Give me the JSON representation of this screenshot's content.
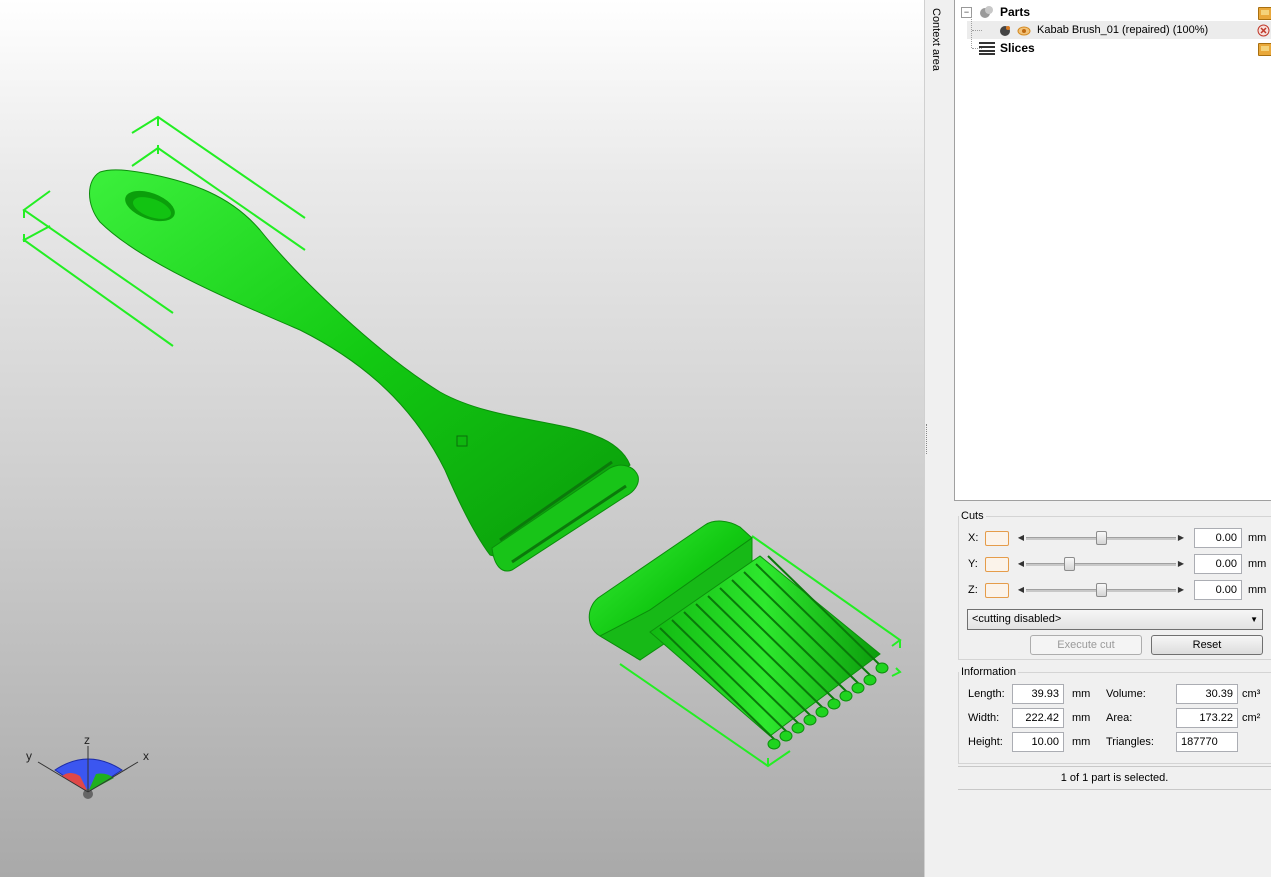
{
  "viewport": {
    "model_color": "#1ed61e",
    "bbox_color": "#23ee23",
    "axes": {
      "x_label": "x",
      "y_label": "y",
      "z_label": "z"
    }
  },
  "context_tab": {
    "label": "Context area"
  },
  "tree": {
    "parts": {
      "label": "Parts"
    },
    "item": {
      "label": "Kabab Brush_01 (repaired) (100%)"
    },
    "slices": {
      "label": "Slices"
    }
  },
  "cuts": {
    "title": "Cuts",
    "x": {
      "label": "X:",
      "value": "0.00",
      "unit": "mm",
      "slider_pos": 0.5
    },
    "y": {
      "label": "Y:",
      "value": "0.00",
      "unit": "mm",
      "slider_pos": 0.27
    },
    "z": {
      "label": "Z:",
      "value": "0.00",
      "unit": "mm",
      "slider_pos": 0.5
    },
    "mode": "<cutting disabled>",
    "execute_label": "Execute cut",
    "reset_label": "Reset"
  },
  "info": {
    "title": "Information",
    "length": {
      "label": "Length:",
      "value": "39.93",
      "unit": "mm"
    },
    "width": {
      "label": "Width:",
      "value": "222.42",
      "unit": "mm"
    },
    "height": {
      "label": "Height:",
      "value": "10.00",
      "unit": "mm"
    },
    "volume": {
      "label": "Volume:",
      "value": "30.39",
      "unit": "cm³"
    },
    "area": {
      "label": "Area:",
      "value": "173.22",
      "unit": "cm²"
    },
    "triangles": {
      "label": "Triangles:",
      "value": "187770"
    }
  },
  "status": "1 of 1 part is selected."
}
